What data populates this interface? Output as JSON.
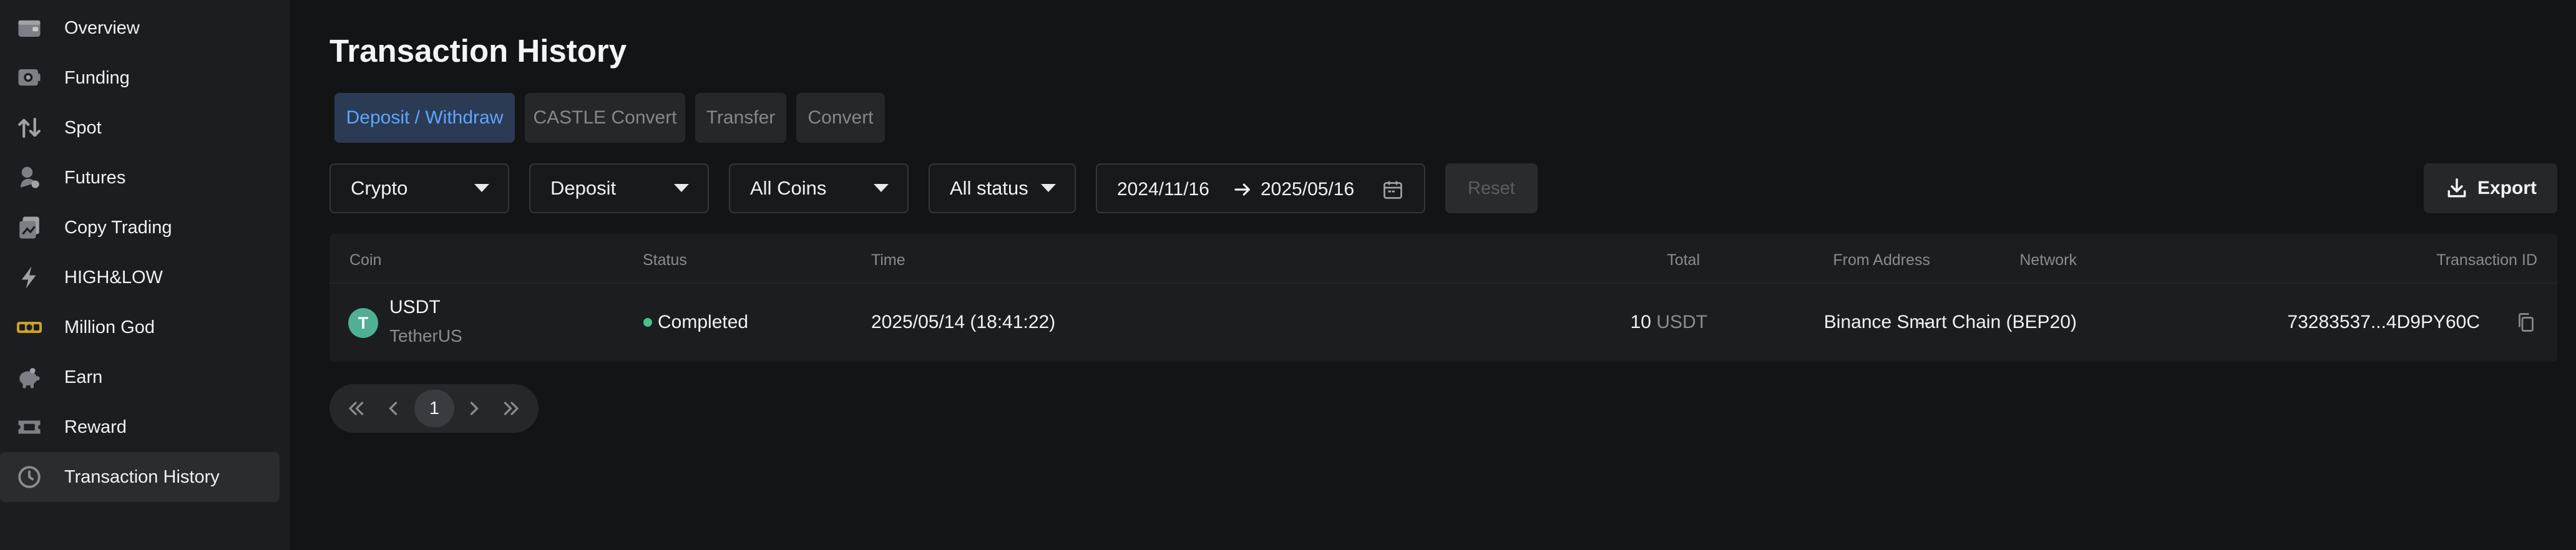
{
  "sidebar": {
    "items": [
      {
        "label": "Overview",
        "icon": "wallet-icon"
      },
      {
        "label": "Funding",
        "icon": "safe-icon"
      },
      {
        "label": "Spot",
        "icon": "swap-arrows-icon"
      },
      {
        "label": "Futures",
        "icon": "futures-icon"
      },
      {
        "label": "Copy Trading",
        "icon": "copy-trading-icon"
      },
      {
        "label": "HIGH&LOW",
        "icon": "lightning-icon"
      },
      {
        "label": "Million God",
        "icon": "god-badge-icon"
      },
      {
        "label": "Earn",
        "icon": "piggy-bank-icon"
      },
      {
        "label": "Reward",
        "icon": "ticket-icon"
      },
      {
        "label": "Transaction History",
        "icon": "clock-icon",
        "active": true
      }
    ]
  },
  "page": {
    "title": "Transaction History"
  },
  "tabs": [
    {
      "label": "Deposit / Withdraw",
      "active": true
    },
    {
      "label": "CASTLE Convert"
    },
    {
      "label": "Transfer"
    },
    {
      "label": "Convert"
    }
  ],
  "filters": {
    "account": "Crypto",
    "type": "Deposit",
    "coins": "All Coins",
    "status": "All status",
    "date_from": "2024/11/16",
    "date_to": "2025/05/16",
    "reset_label": "Reset",
    "export_label": "Export"
  },
  "table": {
    "columns": [
      "Coin",
      "Status",
      "Time",
      "Total",
      "From Address",
      "Network",
      "Transaction ID"
    ],
    "rows": [
      {
        "coin": "USDT",
        "coin_name": "TetherUS",
        "coin_icon_letter": "T",
        "status": "Completed",
        "time": "2025/05/14 (18:41:22)",
        "total_amount": "10",
        "total_unit": "USDT",
        "from_address": "--",
        "network": "Binance Smart Chain (BEP20)",
        "tx_id": "73283537...4D9PY60C"
      }
    ]
  },
  "pagination": {
    "current_page": "1"
  },
  "colors": {
    "background": "#131416",
    "sidebar": "#1c1d20",
    "accent": "#5ea4ff",
    "status_completed": "#45c487",
    "usdt": "#50af95"
  }
}
